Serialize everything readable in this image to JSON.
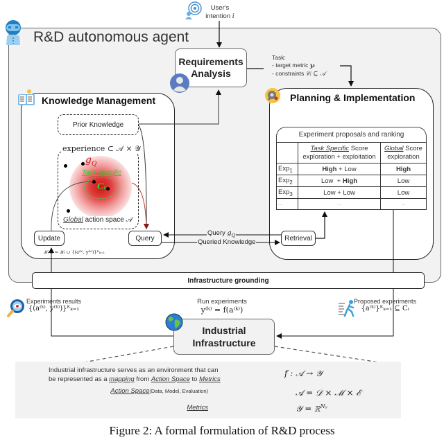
{
  "user_intention": {
    "label_line1": "User's",
    "label_line2": "intention",
    "symbol": "i"
  },
  "agent": {
    "title": "R&D autonomous agent"
  },
  "requirements": {
    "title_line1": "Requirements",
    "title_line2": "Analysis"
  },
  "task": {
    "heading": "Task:",
    "line1_text": "- target metric ",
    "line1_math": "yᵢ",
    "line2_text": "- constraints ",
    "line2_math": "𝒞ᵢ ⊆ 𝒜"
  },
  "knowledge_management": {
    "title": "Knowledge Management",
    "prior_knowledge": "Prior Knowledge",
    "experience_label": "experience ⊂ 𝒜 × 𝒴",
    "g_q": "g",
    "g_q_sub": "Q",
    "task_specific": "Task specific",
    "c_i": "Cᵢ",
    "global_label": "Global",
    "action_space_label": " action space 𝒜",
    "update_button": "Update",
    "query_button": "Query",
    "update_formula": "𝒦ₜ₊₁ = 𝒦ₜ ∪ {(a⁽ᵏ⁾, y⁽ᵏ⁾)}ᴷₖ₌₁"
  },
  "planning": {
    "title": "Planning & Implementation",
    "table_title": "Experiment proposals and ranking",
    "columns": [
      {
        "label_italic": "Task Specific",
        "label_rest": " Score",
        "sub": "exploration + exploitation"
      },
      {
        "label_italic": "Global",
        "label_rest": " Score",
        "sub": "exploration"
      }
    ],
    "rows": [
      {
        "name": "Exp",
        "sub": "1",
        "task_a": "High",
        "task_a_bold": true,
        "task_b": " + Low",
        "task_b_bold": false,
        "global": "High",
        "global_bold": true
      },
      {
        "name": "Exp",
        "sub": "2",
        "task_a": "Low  + ",
        "task_a_bold": false,
        "task_b": "High",
        "task_b_bold": true,
        "global": "Low",
        "global_bold": false
      },
      {
        "name": "Exp",
        "sub": "3",
        "task_a": "Low + Low",
        "task_a_bold": false,
        "task_b": "",
        "task_b_bold": false,
        "global": "Low",
        "global_bold": false
      },
      {
        "name": "...",
        "sub": "",
        "task_a": "...",
        "task_a_bold": false,
        "task_b": "",
        "task_b_bold": false,
        "global": "...",
        "global_bold": false
      }
    ],
    "retrieval_button": "Retrieval"
  },
  "links": {
    "query_gq": "Query ",
    "query_gq_math": "g",
    "query_gq_sub": "Q",
    "queried_knowledge": "Queried Knowledge"
  },
  "infrastructure_grounding": "Infrastructure grounding",
  "experiments_results": {
    "label": "Experiments results",
    "formula": "{(a⁽ᵏ⁾, y⁽ᵏ⁾)}ᴷₖ₌₁"
  },
  "run_experiments": {
    "label": "Run experiments",
    "formula": "y⁽ᵏ⁾ = f(a⁽ᵏ⁾)"
  },
  "proposed_experiments": {
    "label": "Proposed experiments",
    "formula": "{a⁽ᵏ⁾}ᴷₖ₌₁ ⊆ Cᵢ"
  },
  "industrial": {
    "title_line1": "Industrial",
    "title_line2": "Infrastructure"
  },
  "description": {
    "line1": "Industrial infrastructure serves as an environment that can",
    "line2_a": "be represented as a ",
    "line2_mapping": "mapping",
    "line2_b": " from ",
    "line2_action": "Action Space",
    "line2_c": " to ",
    "line2_metrics": "Metrics",
    "formula1": "f : 𝒜 → 𝒴",
    "action_space_label": "Action Space",
    "action_space_sub": "(Data, Model, Evaluation)",
    "formula2": "𝒜 = 𝒟 × ℳ × ℰ",
    "metrics_label": "Metrics",
    "formula3": "𝒴 = ℝ",
    "formula3_sup": "Nᵧ"
  },
  "caption": "Figure 2: A formal formulation of R&D process",
  "icons": {
    "user_target": "target-user-icon",
    "robot": "robot-icon",
    "person": "person-icon",
    "book": "book-lightbulb-icon",
    "gear": "gear-icon",
    "magnifier": "magnifier-eye-icon",
    "runner": "running-person-icon",
    "globe": "globe-icon"
  }
}
